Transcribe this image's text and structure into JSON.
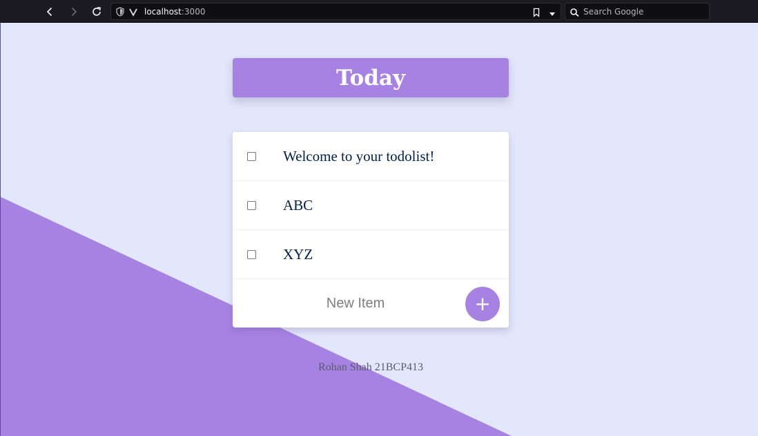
{
  "browser": {
    "url_host": "localhost",
    "url_port": ":3000",
    "search_placeholder": "Search Google"
  },
  "page": {
    "title": "Today",
    "items": [
      {
        "label": "Welcome to your todolist!",
        "checked": false
      },
      {
        "label": "ABC",
        "checked": false
      },
      {
        "label": "XYZ",
        "checked": false
      }
    ],
    "new_item_placeholder": "New Item",
    "add_button_label": "+",
    "footer": "Rohan Shah 21BCP413"
  },
  "colors": {
    "accent": "#a683e3",
    "background": "#e2e7fb",
    "item_text": "#00204a"
  },
  "icons": [
    "back-icon",
    "forward-icon",
    "reload-icon",
    "shield-icon",
    "v-logo-icon",
    "bookmark-icon",
    "dropdown-icon",
    "search-icon"
  ]
}
